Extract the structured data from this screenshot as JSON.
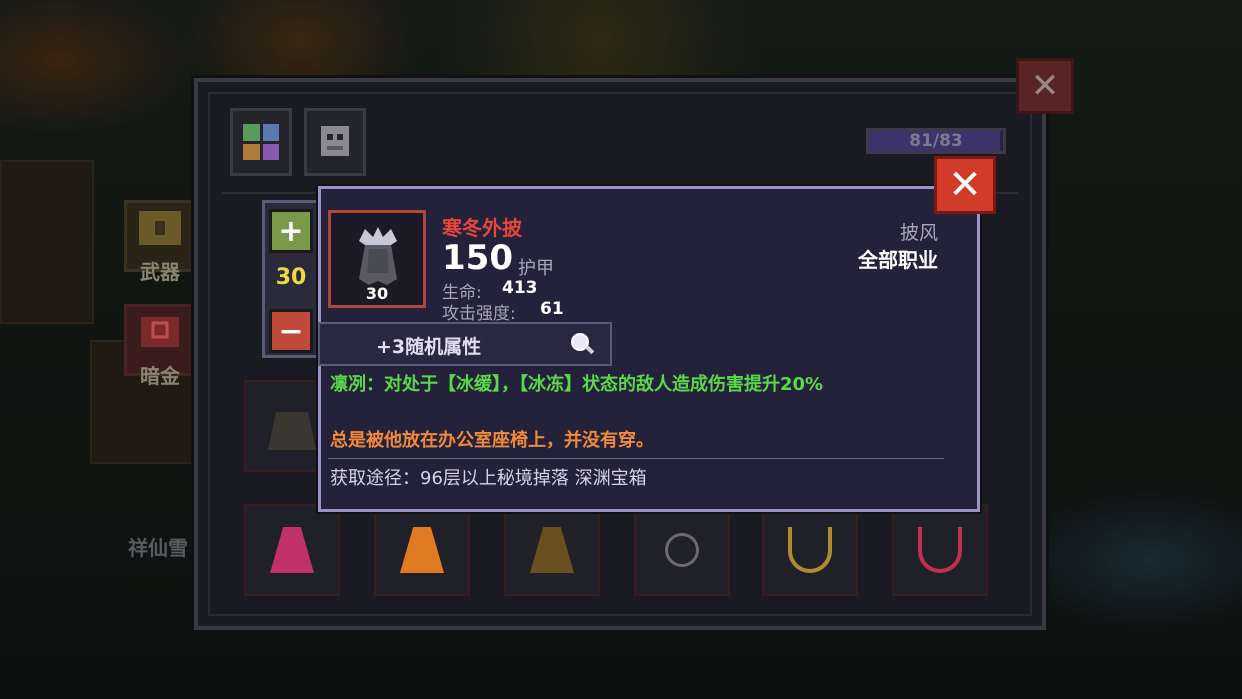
{
  "panel": {
    "capacity": "81/83",
    "capacity_fraction": 0.976
  },
  "side_menu": [
    {
      "label": "武器",
      "icon": "weapon-chest-icon"
    },
    {
      "label": "暗金",
      "icon": "dark-gold-chest-icon"
    }
  ],
  "npc_name": "祥仙雪",
  "stepper": {
    "quantity": "30",
    "plus": "+",
    "minus": "−"
  },
  "tooltip": {
    "close": "✕",
    "item_name": "寒冬外披",
    "item_level": "30",
    "armor_value": "150",
    "armor_label": "护甲",
    "stats": [
      {
        "label": "生命:",
        "value": "413"
      },
      {
        "label": "攻击强度:",
        "value": "61"
      }
    ],
    "slot_type": "披风",
    "class_requirement": "全部职业",
    "random_affix": "+3随机属性",
    "effect_text": "凛冽：对处于【冰缓】，【冰冻】状态的敌人造成伤害提升20%",
    "flavor_text": "总是被他放在办公室座椅上，并没有穿。",
    "source_text": "获取途径：96层以上秘境掉落 深渊宝箱"
  },
  "panel_close": "✕",
  "bottom_slots": [
    {
      "icon": "pink-cloak-icon",
      "color": "#c0306a"
    },
    {
      "icon": "fire-cloak-icon",
      "color": "#e07a20"
    },
    {
      "icon": "golden-bell-cloak-icon",
      "color": "#6a5020"
    },
    {
      "icon": "empty-necklace-icon",
      "color": "#6a6a70"
    },
    {
      "icon": "gold-necklace-icon",
      "color": "#b08a30"
    },
    {
      "icon": "heart-necklace-icon",
      "color": "#c03050"
    }
  ],
  "colors": {
    "item_name": "#e8463a",
    "effect": "#5ad84a",
    "flavor": "#f08a3a",
    "quantity": "#f0d840"
  }
}
